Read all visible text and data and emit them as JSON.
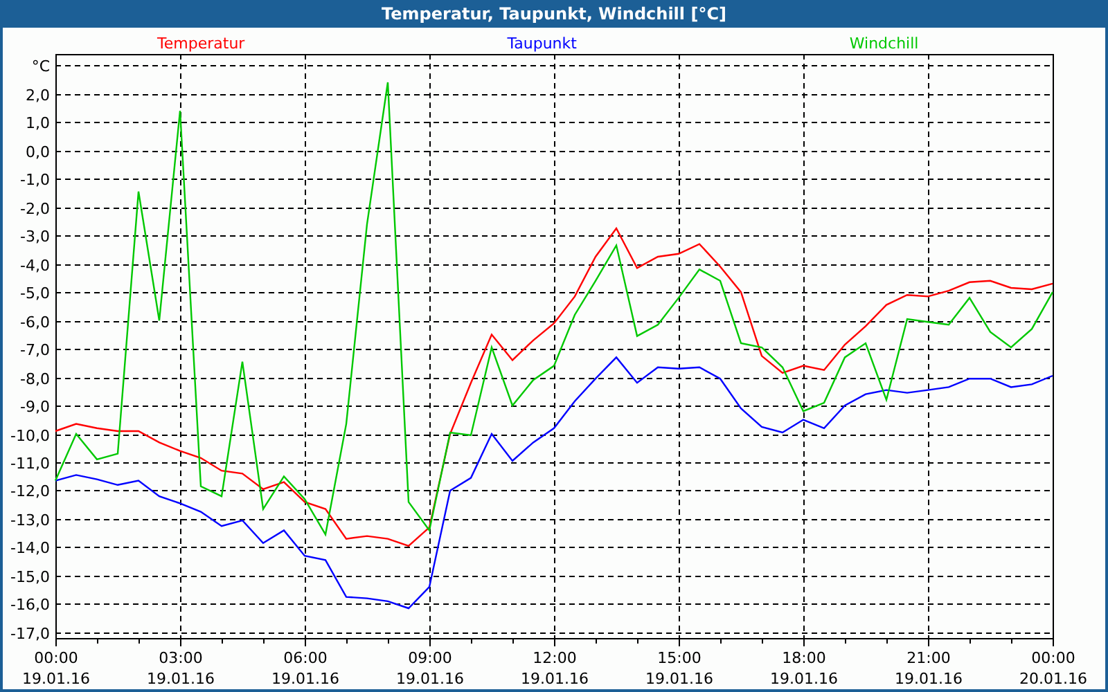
{
  "window": {
    "title": "Temperatur, Taupunkt, Windchill [°C]"
  },
  "chart": {
    "chart_data": {
      "type": "line",
      "categories": [
        "00:00 19.01.16",
        null,
        null,
        null,
        null,
        null,
        "03:00 19.01.16",
        null,
        null,
        null,
        null,
        null,
        "06:00 19.01.16",
        null,
        null,
        null,
        null,
        null,
        "09:00 19.01.16",
        null,
        null,
        null,
        null,
        null,
        "12:00 19.01.16",
        null,
        null,
        null,
        null,
        null,
        "15:00 19.01.16",
        null,
        null,
        null,
        null,
        null,
        "18:00 19.01.16",
        null,
        null,
        null,
        null,
        null,
        "21:00 19.01.16",
        null,
        null,
        null,
        null,
        null,
        "00:00 20.01.16"
      ],
      "series": [
        {
          "name": "Temperatur",
          "color": "#ff0000",
          "values": [
            -9.9,
            -9.65,
            -9.8,
            -9.9,
            -9.9,
            -10.3,
            -10.6,
            -10.85,
            -11.3,
            -11.4,
            -11.95,
            -11.7,
            -12.4,
            -12.65,
            -13.7,
            -13.6,
            -13.7,
            -13.95,
            -13.3,
            -10.0,
            -8.2,
            -6.5,
            -7.4,
            -6.7,
            -6.1,
            -5.15,
            -3.75,
            -2.75,
            -4.15,
            -3.75,
            -3.65,
            -3.3,
            -4.1,
            -5.0,
            -7.25,
            -7.85,
            -7.6,
            -7.75,
            -6.85,
            -6.2,
            -5.45,
            -5.1,
            -5.15,
            -4.95,
            -4.65,
            -4.6,
            -4.85,
            -4.9,
            -4.7
          ]
        },
        {
          "name": "Taupunkt",
          "color": "#0000ff",
          "values": [
            -11.65,
            -11.45,
            -11.6,
            -11.8,
            -11.65,
            -12.2,
            -12.45,
            -12.75,
            -13.25,
            -13.05,
            -13.85,
            -13.4,
            -14.3,
            -14.45,
            -15.75,
            -15.8,
            -15.9,
            -16.15,
            -15.4,
            -12.0,
            -11.55,
            -10.0,
            -10.95,
            -10.3,
            -9.8,
            -8.85,
            -8.05,
            -7.3,
            -8.2,
            -7.65,
            -7.7,
            -7.65,
            -8.05,
            -9.1,
            -9.75,
            -9.95,
            -9.5,
            -9.8,
            -9.0,
            -8.6,
            -8.45,
            -8.55,
            -8.45,
            -8.35,
            -8.05,
            -8.05,
            -8.35,
            -8.25,
            -7.95
          ]
        },
        {
          "name": "Windchill",
          "color": "#00c800",
          "values": [
            -11.65,
            -10.0,
            -10.9,
            -10.7,
            -1.45,
            -6.0,
            1.4,
            -11.85,
            -12.2,
            -7.45,
            -12.65,
            -11.5,
            -12.3,
            -13.55,
            -9.65,
            -2.6,
            2.4,
            -12.4,
            -13.4,
            -9.95,
            -10.05,
            -6.95,
            -9.0,
            -8.1,
            -7.6,
            -5.8,
            -4.6,
            -3.35,
            -6.55,
            -6.15,
            -5.2,
            -4.2,
            -4.6,
            -6.8,
            -6.95,
            -7.65,
            -9.2,
            -8.9,
            -7.3,
            -6.8,
            -8.8,
            -5.95,
            -6.05,
            -6.15,
            -5.2,
            -6.4,
            -6.95,
            -6.3,
            -5.0
          ]
        }
      ],
      "ylim": [
        -17.2,
        3.4
      ],
      "grid": true,
      "yticks": [
        {
          "value": 3,
          "label": "°C"
        },
        {
          "value": 2,
          "label": "2,0"
        },
        {
          "value": 1,
          "label": "1,0"
        },
        {
          "value": 0,
          "label": "0,0"
        },
        {
          "value": -1,
          "label": "-1,0"
        },
        {
          "value": -2,
          "label": "-2,0"
        },
        {
          "value": -3,
          "label": "-3,0"
        },
        {
          "value": -4,
          "label": "-4,0"
        },
        {
          "value": -5,
          "label": "-5,0"
        },
        {
          "value": -6,
          "label": "-6,0"
        },
        {
          "value": -7,
          "label": "-7,0"
        },
        {
          "value": -8,
          "label": "-8,0"
        },
        {
          "value": -9,
          "label": "-9,0"
        },
        {
          "value": -10,
          "label": "-10,0"
        },
        {
          "value": -11,
          "label": "-11,0"
        },
        {
          "value": -12,
          "label": "-12,0"
        },
        {
          "value": -13,
          "label": "-13,0"
        },
        {
          "value": -14,
          "label": "-14,0"
        },
        {
          "value": -15,
          "label": "-15,0"
        },
        {
          "value": -16,
          "label": "-16,0"
        },
        {
          "value": -17,
          "label": "-17,0"
        }
      ]
    }
  }
}
